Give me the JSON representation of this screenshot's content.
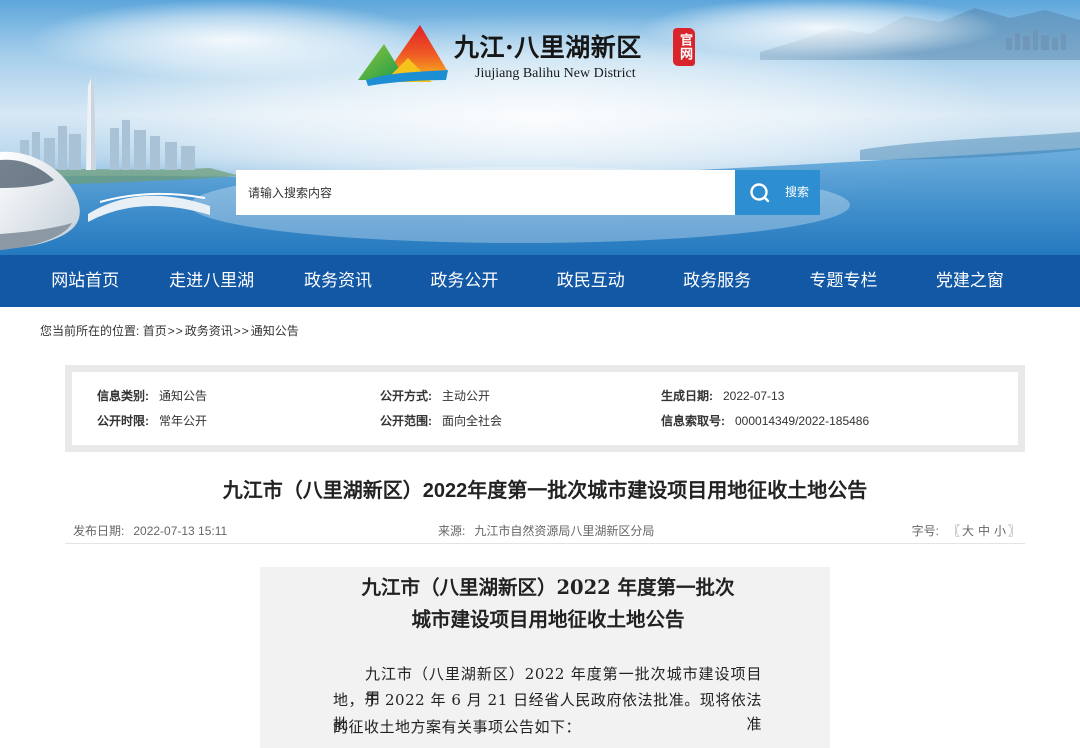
{
  "site": {
    "name_cn": "九江·八里湖新区",
    "seal": "官网",
    "name_en": "Jiujiang Balihu New District",
    "logo_icon": "logo-mountain-icon"
  },
  "search": {
    "placeholder": "请输入搜索内容",
    "button_label": "搜索",
    "button_icon": "search-icon"
  },
  "nav": {
    "items": [
      "网站首页",
      "走进八里湖",
      "政务资讯",
      "政务公开",
      "政民互动",
      "政务服务",
      "专题专栏",
      "党建之窗"
    ]
  },
  "breadcrumb": {
    "prefix": "您当前所在的位置:",
    "items": [
      "首页",
      "政务资讯",
      "通知公告"
    ],
    "separator": ">>"
  },
  "info": {
    "rows": [
      [
        {
          "label": "信息类别:",
          "value": "通知公告"
        },
        {
          "label": "公开方式:",
          "value": "主动公开"
        },
        {
          "label": "生成日期:",
          "value": "2022-07-13"
        }
      ],
      [
        {
          "label": "公开时限:",
          "value": "常年公开"
        },
        {
          "label": "公开范围:",
          "value": "面向全社会"
        },
        {
          "label": "信息索取号:",
          "value": "000014349/2022-185486"
        }
      ]
    ]
  },
  "article": {
    "title": "九江市（八里湖新区）2022年度第一批次城市建设项目用地征收土地公告",
    "meta": {
      "date_label": "发布日期:",
      "date": "2022-07-13 15:11",
      "source_label": "来源:",
      "source": "九江市自然资源局八里湖新区分局",
      "size_label": "字号:",
      "size_open": "〖",
      "size_options": [
        "大",
        "中",
        "小"
      ],
      "size_close": "〗"
    }
  },
  "document": {
    "title_lines": [
      "九江市（八里湖新区）2022 年度第一批次",
      "城市建设项目用地征收土地公告"
    ],
    "body_lines": [
      "九江市（八里湖新区）2022 年度第一批次城市建设项目用",
      "地，于 2022 年 6 月 21 日经省人民政府依法批准。现将依法批准",
      "的征收土地方案有关事项公告如下："
    ]
  },
  "colors": {
    "nav_bg": "#1358a5",
    "search_button": "#2d8ed2",
    "seal": "#d8242a",
    "info_border": "#e9e9e9",
    "document_bg": "#f2f2f2"
  }
}
